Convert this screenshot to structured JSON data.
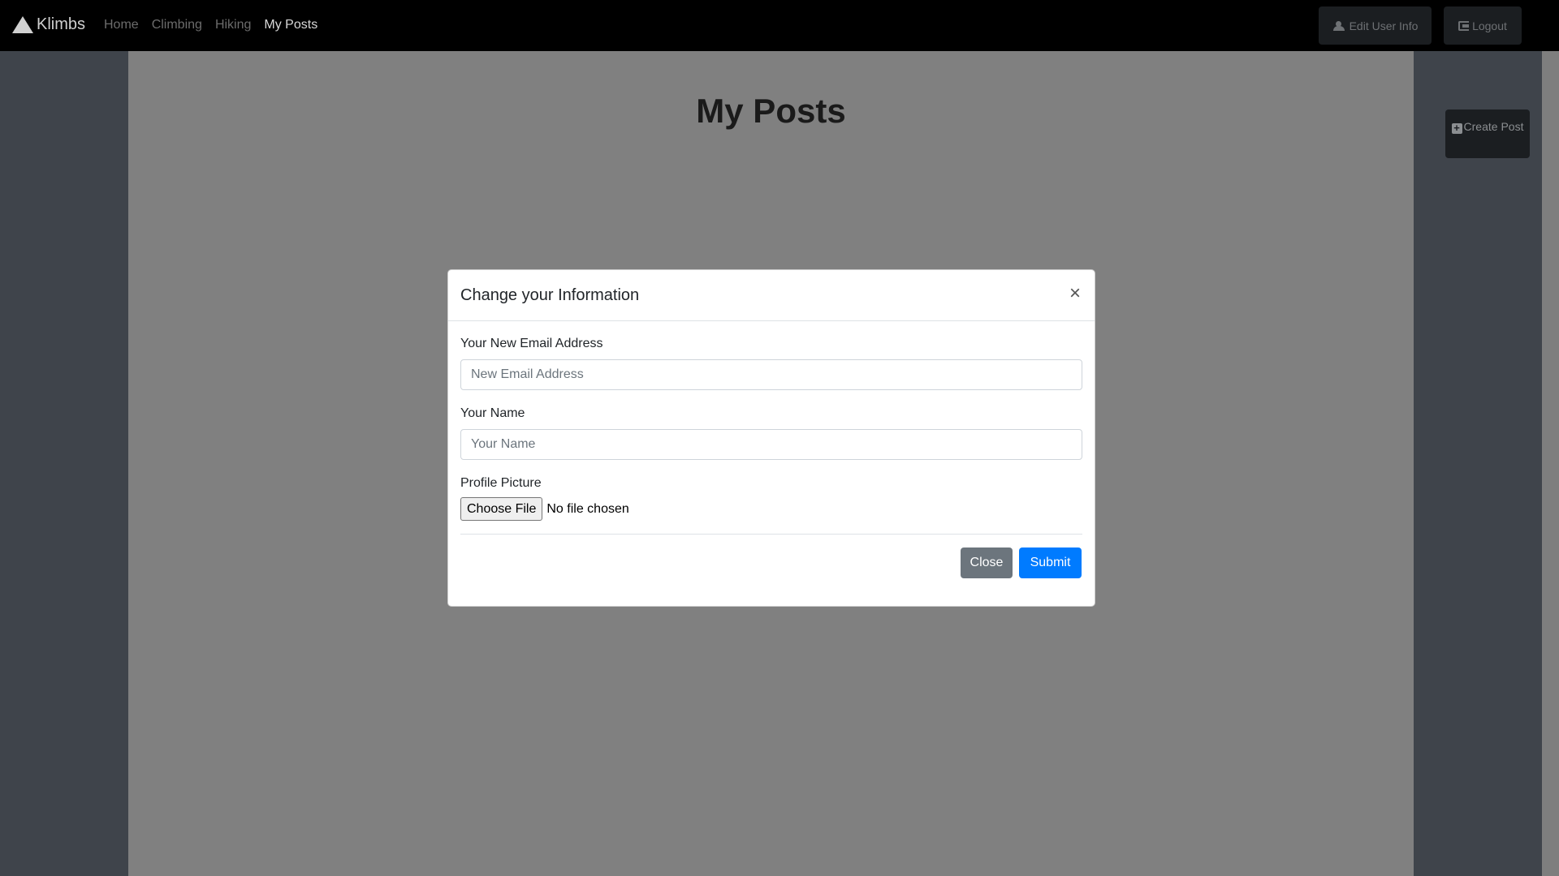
{
  "navbar": {
    "brand": "Klimbs",
    "links": [
      "Home",
      "Climbing",
      "Hiking",
      "My Posts"
    ],
    "active_link": "My Posts",
    "edit_user_info": "Edit User Info",
    "logout": "Logout"
  },
  "page": {
    "title": "My Posts",
    "create_post": "Create Post"
  },
  "modal": {
    "title": "Change your Information",
    "close_glyph": "×",
    "email_label": "Your New Email Address",
    "email_placeholder": "New Email Address",
    "name_label": "Your Name",
    "name_placeholder": "Your Name",
    "picture_label": "Profile Picture",
    "choose_file": "Choose File",
    "file_status": "No file chosen",
    "close_button": "Close",
    "submit_button": "Submit"
  },
  "colors": {
    "primary": "#007bff",
    "secondary": "#6c757d",
    "navbar_bg": "#000000"
  }
}
